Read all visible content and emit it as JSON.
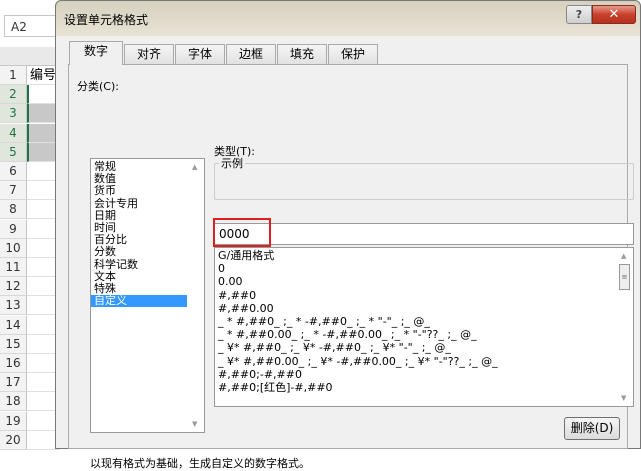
{
  "excel": {
    "name_box": "A2",
    "rows": [
      "1",
      "2",
      "3",
      "4",
      "5",
      "6",
      "7",
      "8",
      "9",
      "10",
      "11",
      "12",
      "13",
      "14",
      "15",
      "16",
      "17",
      "18",
      "19",
      "20"
    ],
    "cell_a1": "编号"
  },
  "dialog": {
    "title": "设置单元格格式",
    "help": "?",
    "close": "✕",
    "tabs": [
      "数字",
      "对齐",
      "字体",
      "边框",
      "填充",
      "保护"
    ],
    "category_label": "分类(C):",
    "categories": [
      "常规",
      "数值",
      "货币",
      "会计专用",
      "日期",
      "时间",
      "百分比",
      "分数",
      "科学记数",
      "文本",
      "特殊",
      "自定义"
    ],
    "sample_label": "示例",
    "type_label": "类型(T):",
    "type_value": "0000",
    "formats": [
      "G/通用格式",
      "0",
      "0.00",
      "#,##0",
      "#,##0.00",
      "_ * #,##0_ ;_ * -#,##0_ ;_ * \"-\"_ ;_ @_",
      "_ * #,##0.00_ ;_ * -#,##0.00_ ;_ * \"-\"??_ ;_ @_",
      "_ ¥* #,##0_ ;_ ¥* -#,##0_ ;_ ¥* \"-\"_ ;_ @_",
      "_ ¥* #,##0.00_ ;_ ¥* -#,##0.00_ ;_ ¥* \"-\"??_ ;_ @_",
      "#,##0;-#,##0",
      "#,##0;[红色]-#,##0"
    ],
    "delete_button": "删除(D)",
    "description": "以现有格式为基础，生成自定义的数字格式。"
  }
}
